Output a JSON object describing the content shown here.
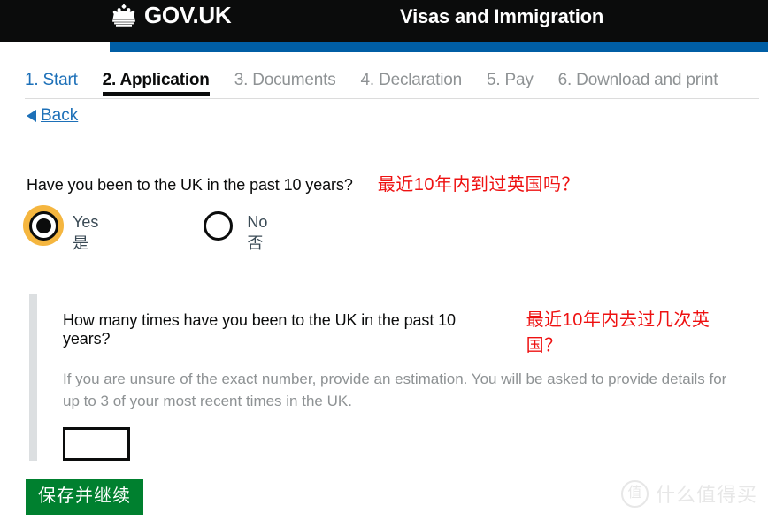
{
  "header": {
    "logo_text": "GOV.UK",
    "crown_icon": "crown-icon",
    "service_title": "Visas and Immigration"
  },
  "tabs": [
    {
      "label": "1. Start",
      "state": "link"
    },
    {
      "label": "2. Application",
      "state": "current"
    },
    {
      "label": "3. Documents",
      "state": "muted"
    },
    {
      "label": "4. Declaration",
      "state": "muted"
    },
    {
      "label": "5. Pay",
      "state": "muted"
    },
    {
      "label": "6. Download and print",
      "state": "muted"
    }
  ],
  "back": {
    "label": "Back",
    "arrow_icon": "back-arrow-icon"
  },
  "question": {
    "text_en": "Have you been to the UK in the past 10 years?",
    "text_zh": "最近10年内到过英国吗？"
  },
  "radios": {
    "yes": {
      "label_en": "Yes",
      "label_zh": "是",
      "selected": true,
      "focused": true
    },
    "no": {
      "label_en": "No",
      "label_zh": "否",
      "selected": false,
      "focused": false
    }
  },
  "conditional": {
    "sub_question_en": "How many times have you been to the UK in the past 10 years?",
    "sub_question_zh": "最近10年内去过几次英国？",
    "hint": "If you are unsure of the exact number, provide an estimation. You will be asked to provide details for up to 3 of your most recent times in the UK.",
    "input_value": "",
    "input_placeholder": ""
  },
  "submit": {
    "label": "保存并继续"
  },
  "watermark": {
    "badge": "值",
    "text": "什么值得买"
  },
  "colors": {
    "header_black": "#0b0c0c",
    "brand_blue": "#005ea5",
    "link_blue": "#1d70b8",
    "muted_grey": "#8e9294",
    "focus_yellow": "#f5b63f",
    "annotation_red": "#ee1111",
    "button_green": "#00802f",
    "panel_grey": "#dcdfe1"
  }
}
